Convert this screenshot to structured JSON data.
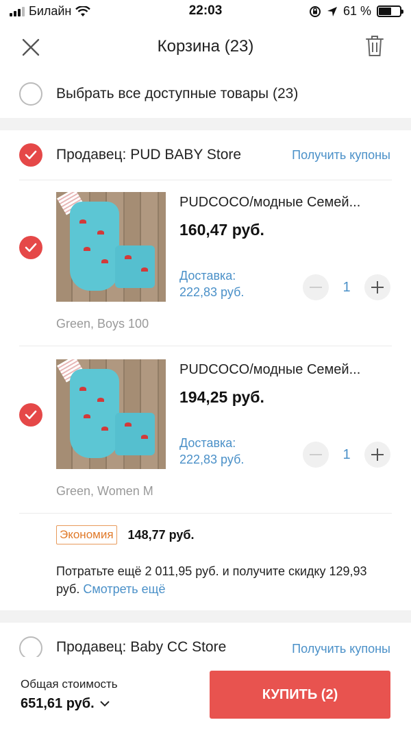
{
  "status_bar": {
    "carrier": "Билайн",
    "time": "22:03",
    "battery_text": "61 %",
    "battery_level": 0.61
  },
  "nav": {
    "title": "Корзина (23)",
    "close_icon": "close-icon",
    "delete_icon": "trash-icon"
  },
  "select_all": {
    "label": "Выбрать все доступные товары (23)",
    "checked": false
  },
  "stores": [
    {
      "name": "Продавец: PUD BABY Store",
      "coupon_link": "Получить купоны",
      "checked": true,
      "items": [
        {
          "title": "PUDCOCO/модные Семей...",
          "price": "160,47 руб.",
          "shipping_label": "Доставка:",
          "shipping_price": "222,83 руб.",
          "quantity": "1",
          "variant": "Green, Boys 100",
          "checked": true
        },
        {
          "title": "PUDCOCO/модные Семей...",
          "price": "194,25 руб.",
          "shipping_label": "Доставка:",
          "shipping_price": "222,83 руб.",
          "quantity": "1",
          "variant": "Green, Women M",
          "checked": true
        }
      ],
      "saving_badge": "Экономия",
      "saving_amount": "148,77 руб.",
      "promo_text": "Потратьте ещё 2 011,95 руб. и получите скидку 129,93 руб.",
      "promo_link": "Смотреть ещё"
    },
    {
      "name": "Продавец: Baby CC Store",
      "coupon_link": "Получить купоны",
      "checked": false
    }
  ],
  "footer": {
    "total_label": "Общая стоимость",
    "total_value": "651,61 руб.",
    "buy_button": "КУПИТЬ (2)"
  },
  "colors": {
    "accent_red": "#e8534f",
    "check_red": "#e54848",
    "link_blue": "#4a90c8",
    "saving_orange": "#e07a2a"
  }
}
